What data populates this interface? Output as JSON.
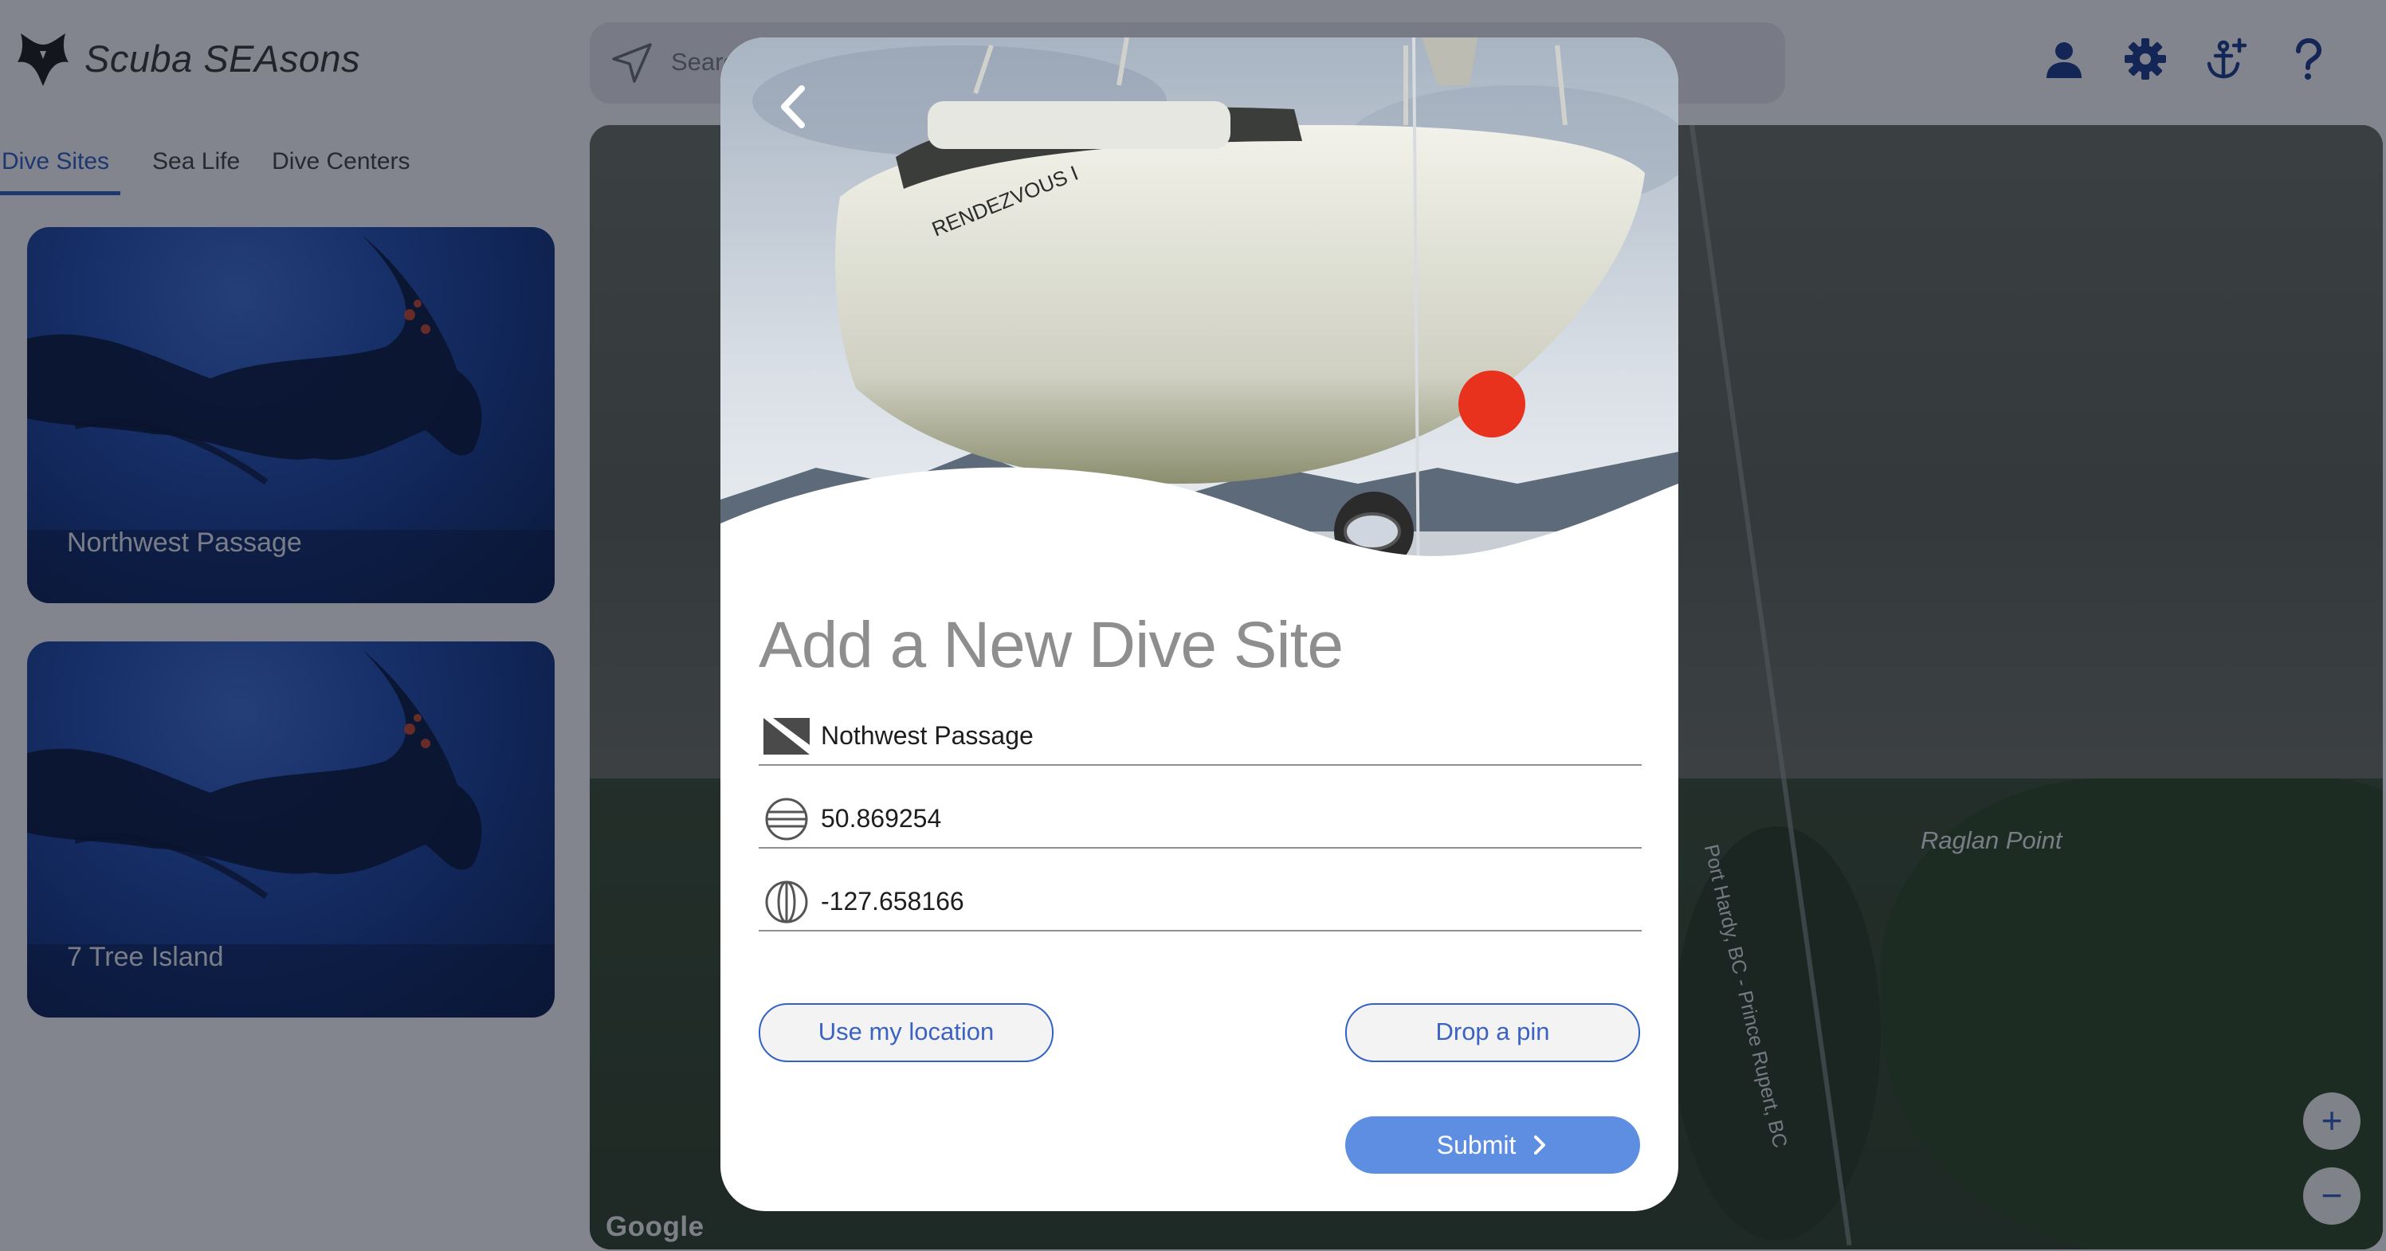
{
  "app": {
    "title": "Scuba SEAsons"
  },
  "tabs": [
    {
      "label": "Dive Sites"
    },
    {
      "label": "Sea Life"
    },
    {
      "label": "Dive Centers"
    }
  ],
  "search": {
    "placeholder": "Search"
  },
  "cards": [
    {
      "title": "Northwest Passage"
    },
    {
      "title": "7 Tree Island"
    }
  ],
  "map": {
    "point_label": "Raglan Point",
    "road_label": "Port Hardy, BC - Prince Rupert, BC",
    "attribution": "Google",
    "zoom_in": "+",
    "zoom_out": "−"
  },
  "modal": {
    "title": "Add a New Dive Site",
    "hero_boat_name": "RENDEZVOUS I",
    "fields": {
      "site_name": "Nothwest Passage",
      "latitude": "50.869254",
      "longitude": "-127.658166"
    },
    "buttons": {
      "use_location": "Use my location",
      "drop_pin": "Drop a pin",
      "submit": "Submit"
    }
  },
  "colors": {
    "accent": "#3461c7",
    "submit": "#5d8ee2"
  }
}
